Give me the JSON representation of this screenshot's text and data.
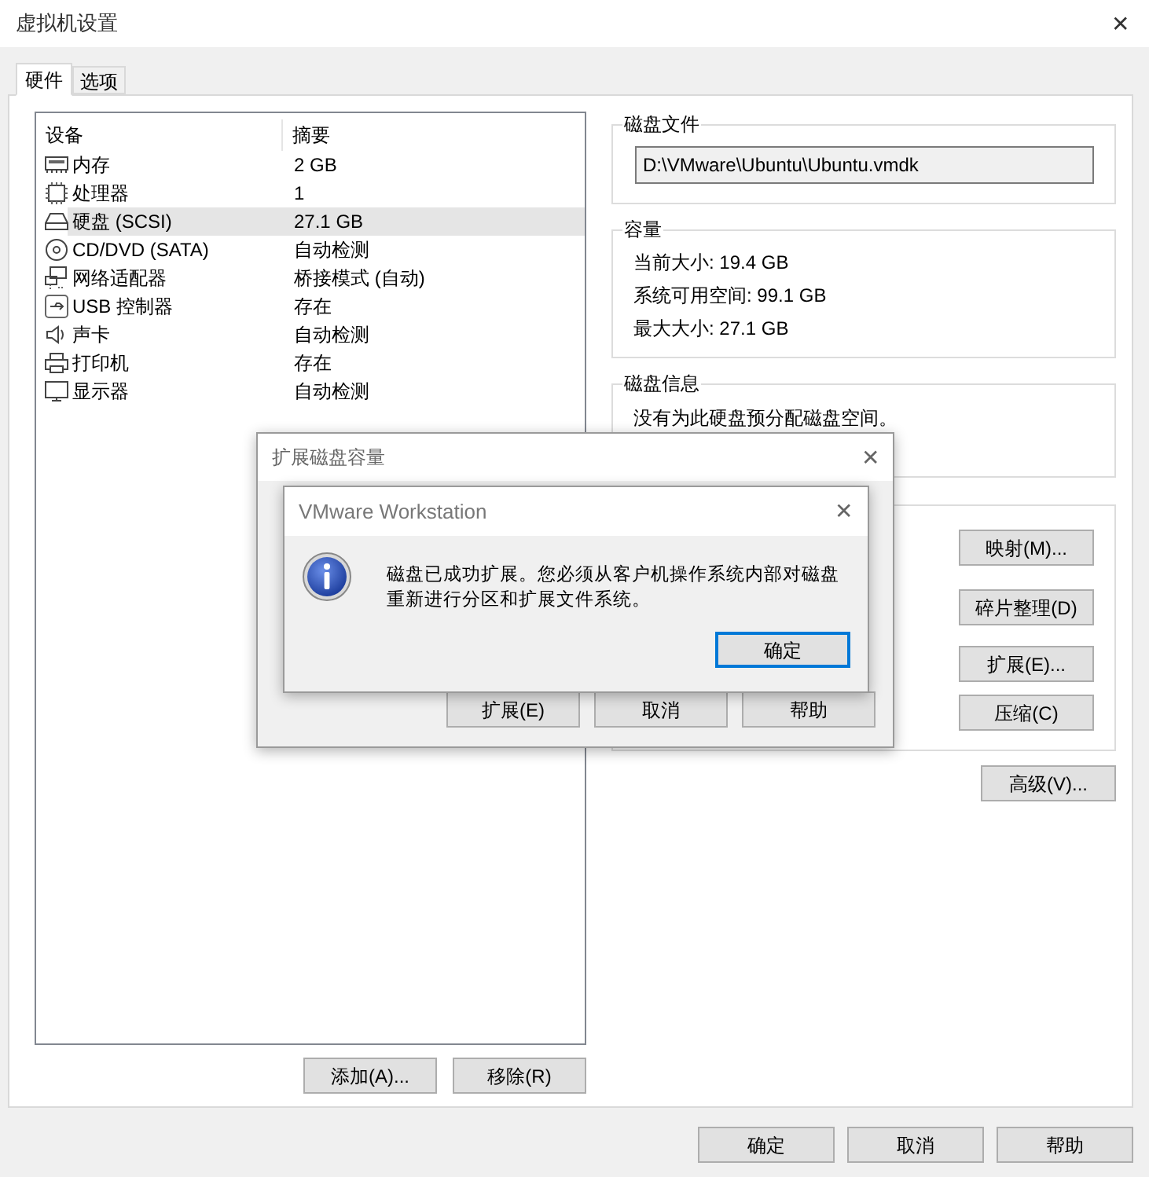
{
  "window": {
    "title": "虚拟机设置",
    "close": "✕"
  },
  "tabs": [
    {
      "label": "硬件",
      "selected": true
    },
    {
      "label": "选项",
      "selected": false
    }
  ],
  "device_list": {
    "columns": [
      "设备",
      "摘要"
    ],
    "rows": [
      {
        "kind": "memory",
        "device": "内存",
        "summary": "2 GB",
        "selected": false
      },
      {
        "kind": "cpu",
        "device": "处理器",
        "summary": "1",
        "selected": false
      },
      {
        "kind": "disk",
        "device": "硬盘 (SCSI)",
        "summary": "27.1 GB",
        "selected": true
      },
      {
        "kind": "cd",
        "device": "CD/DVD (SATA)",
        "summary": "自动检测",
        "selected": false
      },
      {
        "kind": "network",
        "device": "网络适配器",
        "summary": "桥接模式 (自动)",
        "selected": false
      },
      {
        "kind": "usb",
        "device": "USB 控制器",
        "summary": "存在",
        "selected": false
      },
      {
        "kind": "sound",
        "device": "声卡",
        "summary": "自动检测",
        "selected": false
      },
      {
        "kind": "printer",
        "device": "打印机",
        "summary": "存在",
        "selected": false
      },
      {
        "kind": "display",
        "device": "显示器",
        "summary": "自动检测",
        "selected": false
      }
    ],
    "buttons": [
      "添加(A)...",
      "移除(R)"
    ]
  },
  "disk_file": {
    "legend": "磁盘文件",
    "value": "D:\\VMware\\Ubuntu\\Ubuntu.vmdk"
  },
  "capacity": {
    "legend": "容量",
    "lines": [
      "当前大小: 19.4 GB",
      "系统可用空间: 99.1 GB",
      "最大大小: 27.1 GB"
    ]
  },
  "disk_info": {
    "legend": "磁盘信息",
    "text": "没有为此硬盘预分配磁盘空间。"
  },
  "utilities": {
    "buttons": [
      "映射(M)...",
      "碎片整理(D)",
      "扩展(E)...",
      "压缩(C)"
    ]
  },
  "advanced_button": "高级(V)...",
  "footer_buttons": [
    "确定",
    "取消",
    "帮助"
  ],
  "expand_dialog": {
    "title": "扩展磁盘容量",
    "close": "✕",
    "buttons": [
      "扩展(E)",
      "取消",
      "帮助"
    ]
  },
  "message_box": {
    "title": "VMware Workstation",
    "close": "✕",
    "message": "磁盘已成功扩展。您必须从客户机操作系统内部对磁盘重新进行分区和扩展文件系统。",
    "button": "确定"
  }
}
